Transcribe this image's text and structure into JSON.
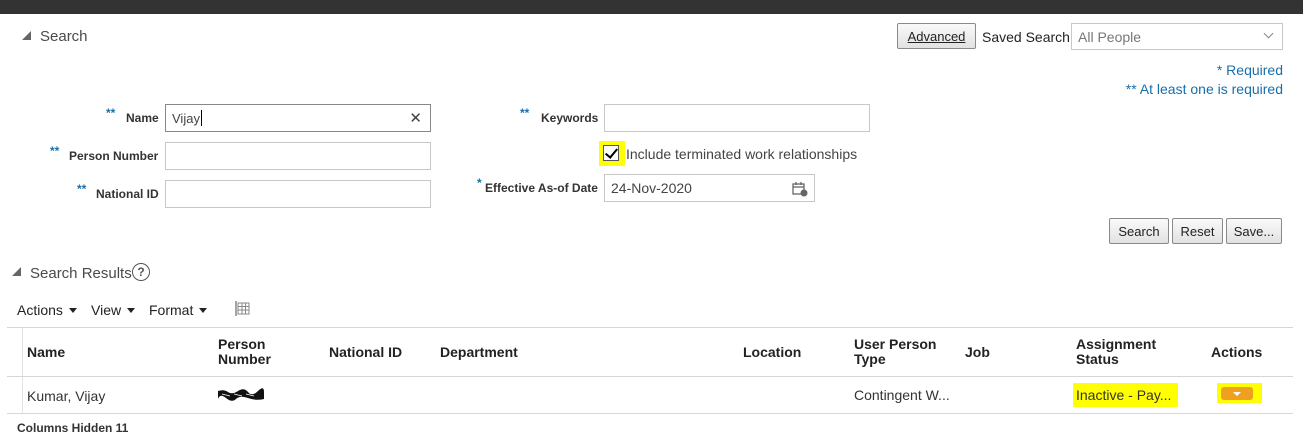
{
  "search": {
    "title": "Search",
    "advanced_label": "Advanced",
    "saved_search_label": "Saved Search",
    "saved_search_value": "All People",
    "required_note": "* Required",
    "at_least_one_note": "** At least one is required",
    "fields": {
      "name_label": "Name",
      "name_marker": "**",
      "name_value": "Vijay",
      "person_number_label": "Person Number",
      "person_number_marker": "**",
      "person_number_value": "",
      "national_id_label": "National ID",
      "national_id_marker": "**",
      "national_id_value": "",
      "keywords_label": "Keywords",
      "keywords_marker": "**",
      "keywords_value": "",
      "terminated_label": "Include terminated work relationships",
      "terminated_checked": true,
      "effective_label": "Effective As-of Date",
      "effective_marker": "*",
      "effective_value": "24-Nov-2020"
    },
    "buttons": {
      "search": "Search",
      "reset": "Reset",
      "save": "Save..."
    }
  },
  "results": {
    "title": "Search Results",
    "toolbar": {
      "actions": "Actions",
      "view": "View",
      "format": "Format"
    },
    "columns": [
      "Name",
      "Person Number",
      "National ID",
      "Department",
      "Location",
      "User Person Type",
      "Job",
      "Assignment Status",
      "Actions"
    ],
    "rows": [
      {
        "name": "Kumar, Vijay",
        "person_number": "",
        "national_id": "",
        "department": "",
        "location": "",
        "user_person_type": "Contingent W...",
        "job": "",
        "assignment_status": "Inactive - Pay..."
      }
    ],
    "footer": "Columns Hidden 11"
  },
  "colors": {
    "link": "#1a6fa8",
    "highlight": "#ffff00",
    "action_button": "#f0a020"
  }
}
